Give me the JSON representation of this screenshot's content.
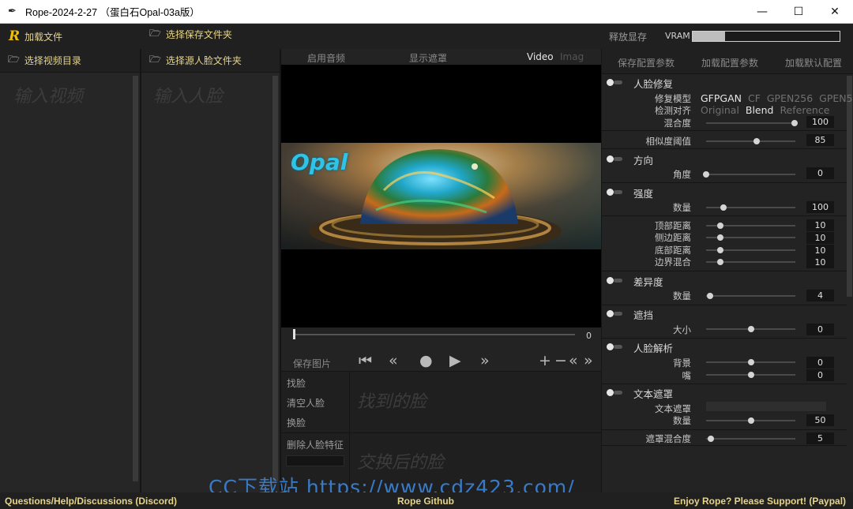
{
  "window": {
    "title": "Rope-2024-2-27 （蛋白石Opal-03a版）"
  },
  "toolbar": {
    "load_files": "加载文件",
    "select_save_folder": "选择保存文件夹",
    "release_vram": "释放显存",
    "vram_label": "VRAM",
    "vram_usage": 0.22
  },
  "videos_col": {
    "header": "选择视频目录",
    "placeholder": "输入视频"
  },
  "faces_col": {
    "header": "选择源人脸文件夹",
    "placeholder": "输入人脸"
  },
  "center": {
    "enable_audio": "启用音频",
    "show_mask": "显示遮罩",
    "video_tab": "Video",
    "image_tab": "Imag",
    "overlay_text": "Opal",
    "frame_value": "0",
    "save_image": "保存图片",
    "find_faces": "找脸",
    "clear_faces": "清空人脸",
    "swap_faces": "换脸",
    "delete_embedding": "删除人脸特征",
    "found_faces_placeholder": "找到的脸",
    "swapped_faces_placeholder": "交换后的脸"
  },
  "right": {
    "save_config": "保存配置参数",
    "load_config": "加载配置参数",
    "load_defaults": "加载默认配置",
    "restorer": {
      "title": "人脸修复",
      "model_label": "修复模型",
      "models": [
        "GFPGAN",
        "CF",
        "GPEN256",
        "GPEN5"
      ],
      "align_label": "检测对齐",
      "aligns": [
        "Original",
        "Blend",
        "Reference"
      ],
      "blend_label": "混合度",
      "blend_value": "100"
    },
    "threshold": {
      "label": "相似度阈值",
      "value": "85"
    },
    "orientation": {
      "title": "方向",
      "angle_label": "角度",
      "angle_value": "0"
    },
    "strength": {
      "title": "强度",
      "amount_label": "数量",
      "amount_value": "100"
    },
    "borders": {
      "top_label": "顶部距离",
      "top_value": "10",
      "sides_label": "侧边距离",
      "sides_value": "10",
      "bottom_label": "底部距离",
      "bottom_value": "10",
      "blend_label": "边界混合",
      "blend_value": "10"
    },
    "diff": {
      "title": "差异度",
      "amount_label": "数量",
      "amount_value": "4"
    },
    "occluder": {
      "title": "遮挡",
      "size_label": "大小",
      "size_value": "0"
    },
    "parser": {
      "title": "人脸解析",
      "bg_label": "背景",
      "bg_value": "0",
      "mouth_label": "嘴",
      "mouth_value": "0"
    },
    "textmask": {
      "title": "文本遮罩",
      "text_label": "文本遮罩",
      "amount_label": "数量",
      "amount_value": "50"
    },
    "mask_blend": {
      "label": "遮罩混合度",
      "value": "5"
    }
  },
  "bottom": {
    "discord": "Questions/Help/Discussions (Discord)",
    "github": "Rope Github",
    "paypal": "Enjoy Rope? Please Support! (Paypal)"
  },
  "watermark": "CC下载站 https://www.cdz423.com/"
}
